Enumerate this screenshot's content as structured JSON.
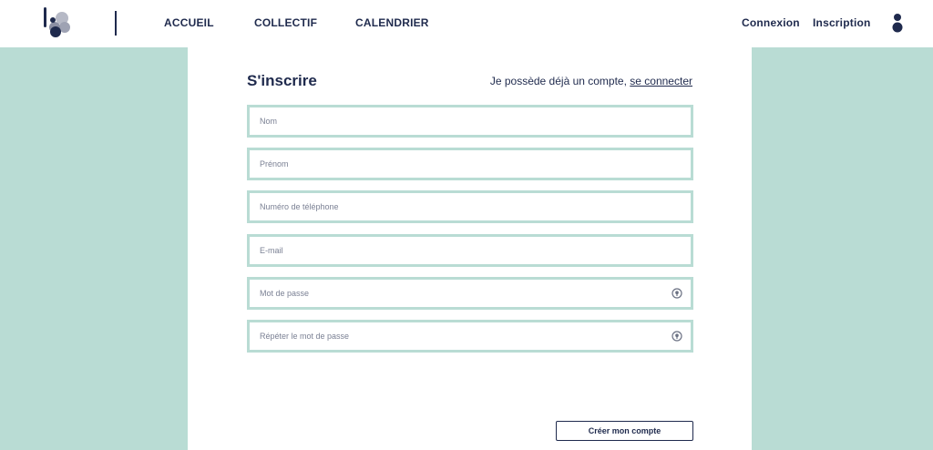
{
  "header": {
    "nav": {
      "accueil": "ACCUEIL",
      "collectif": "COLLECTIF",
      "calendrier": "CALENDRIER"
    },
    "auth": {
      "connexion": "Connexion",
      "inscription": "Inscription"
    },
    "logo_icon": "circles-logo",
    "user_icon": "user-icon"
  },
  "form": {
    "title": "S'inscrire",
    "login_hint": "Je possède déjà un compte, ",
    "login_link": "se connecter",
    "fields": {
      "nom": {
        "placeholder": "Nom",
        "value": ""
      },
      "prenom": {
        "placeholder": "Prénom",
        "value": ""
      },
      "telephone": {
        "placeholder": "Numéro de téléphone",
        "value": ""
      },
      "email": {
        "placeholder": "E-mail",
        "value": ""
      },
      "password": {
        "placeholder": "Mot de passe",
        "value": ""
      },
      "password_repeat": {
        "placeholder": "Répéter le mot de passe",
        "value": ""
      }
    },
    "submit_label": "Créer mon compte"
  },
  "colors": {
    "primary": "#1f2a4d",
    "accent": "#b9dcd4",
    "background": "#ffffff"
  }
}
